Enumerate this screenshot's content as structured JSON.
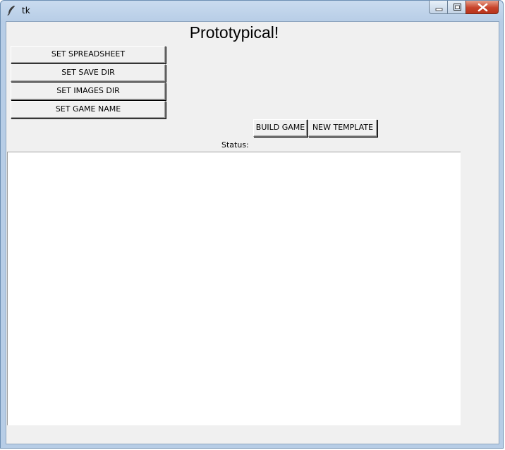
{
  "window": {
    "title": "tk",
    "app_icon": "feather-icon",
    "controls": {
      "minimize_icon": "minimize-icon",
      "maximize_icon": "maximize-icon",
      "close_icon": "close-icon"
    }
  },
  "main": {
    "heading": "Prototypical!",
    "setup_buttons": [
      {
        "label": "SET SPREADSHEET"
      },
      {
        "label": "SET SAVE DIR"
      },
      {
        "label": "SET IMAGES DIR"
      },
      {
        "label": "SET GAME NAME"
      }
    ],
    "action_buttons": [
      {
        "label": "BUILD GAME"
      },
      {
        "label": "NEW TEMPLATE"
      }
    ],
    "status_label": "Status:",
    "output_text": ""
  },
  "colors": {
    "titlebar": "#b9d1ea",
    "client_bg": "#f0f0f0",
    "close_button": "#c7432b"
  }
}
